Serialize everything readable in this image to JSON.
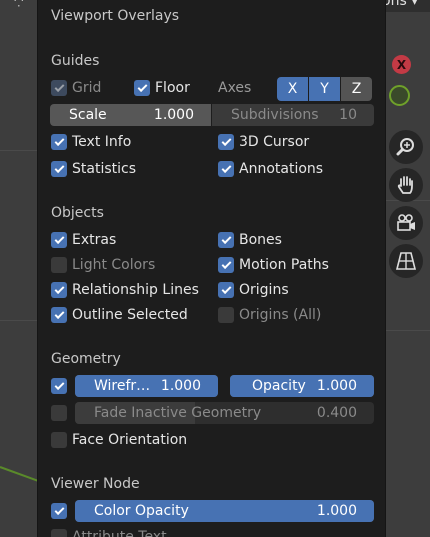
{
  "header": {
    "options_label": "ons"
  },
  "panel": {
    "title": "Viewport Overlays",
    "guides": {
      "title": "Guides",
      "grid_label": "Grid",
      "floor_label": "Floor",
      "axes_label": "Axes",
      "axis_x": "X",
      "axis_y": "Y",
      "axis_z": "Z",
      "scale_label": "Scale",
      "scale_value": "1.000",
      "subdivisions_label": "Subdivisions",
      "subdivisions_value": "10",
      "text_info_label": "Text Info",
      "cursor_label": "3D Cursor",
      "statistics_label": "Statistics",
      "annotations_label": "Annotations"
    },
    "objects": {
      "title": "Objects",
      "extras_label": "Extras",
      "bones_label": "Bones",
      "light_colors_label": "Light Colors",
      "motion_paths_label": "Motion Paths",
      "relationship_lines_label": "Relationship Lines",
      "origins_label": "Origins",
      "outline_selected_label": "Outline Selected",
      "origins_all_label": "Origins (All)"
    },
    "geometry": {
      "title": "Geometry",
      "wireframe_label": "Wirefr…",
      "wireframe_value": "1.000",
      "opacity_label": "Opacity",
      "opacity_value": "1.000",
      "fade_label": "Fade Inactive Geometry",
      "fade_value": "0.400",
      "fade_fraction": 0.4,
      "face_orientation_label": "Face Orientation"
    },
    "viewer_node": {
      "title": "Viewer Node",
      "color_opacity_label": "Color Opacity",
      "color_opacity_value": "1.000",
      "attribute_text_label": "Attribute Text"
    }
  },
  "gizmo": {
    "x_label": "X",
    "x_color": "#c33a45",
    "y_color": "#6fa12a"
  },
  "colors": {
    "accent": "#4772b3",
    "panel_bg": "#1d1d1d",
    "field_bg": "#545454"
  },
  "tools": [
    "zoom-icon",
    "hand-icon",
    "camera-icon",
    "grid-view-icon"
  ]
}
